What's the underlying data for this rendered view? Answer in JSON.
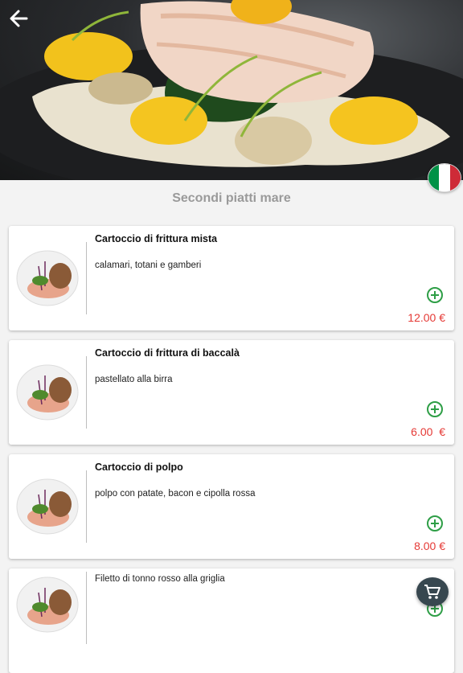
{
  "header": {
    "back_icon": "arrow-left-icon",
    "language_flag": "italy-flag-icon",
    "flag_colors": [
      "#009246",
      "#ffffff",
      "#ce2b37"
    ]
  },
  "section_title": "Secondi piatti mare",
  "items": [
    {
      "name": "Cartoccio di frittura mista",
      "description": "calamari, totani e gamberi",
      "price": "12.00 €"
    },
    {
      "name": "Cartoccio di frittura di baccalà",
      "description": "pastellato alla birra",
      "price": "6.00  €"
    },
    {
      "name": "Cartoccio di polpo",
      "description": "polpo con patate, bacon e cipolla rossa",
      "price": "8.00 €"
    },
    {
      "name": "",
      "description": "Filetto di tonno rosso alla griglia",
      "price": ""
    }
  ],
  "colors": {
    "price": "#e53935",
    "add": "#2e9e46",
    "cart": "#37474f"
  },
  "icons": {
    "add": "plus-circle-icon",
    "cart": "shopping-cart-icon",
    "dish": "dish-photo"
  }
}
